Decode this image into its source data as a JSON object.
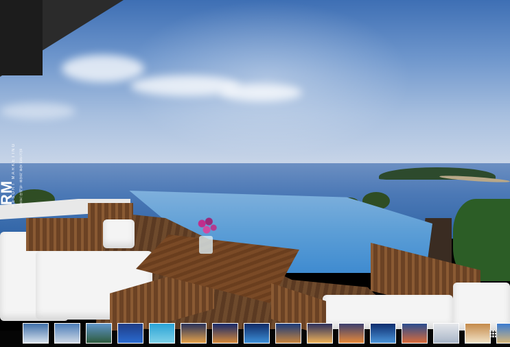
{
  "brand": {
    "logo_text": "RM",
    "tagline": "RESORT MARKETING",
    "subline": "리조트 마케팅 · 휴양지 분양 전문 기업"
  },
  "gallery": {
    "thumbnails": [
      {
        "name": "infinity-pool-sea-view",
        "colors": [
          "#3f6fa8",
          "#d8e2ee"
        ]
      },
      {
        "name": "villa-coast-aerial",
        "colors": [
          "#4b7db8",
          "#cfd9e6"
        ]
      },
      {
        "name": "beach-palms",
        "colors": [
          "#5f94c8",
          "#2d5a3d"
        ]
      },
      {
        "name": "pool-deck-night",
        "colors": [
          "#1f3c86",
          "#2a6bd0"
        ]
      },
      {
        "name": "lagoon-pool",
        "colors": [
          "#2aa3d6",
          "#7fd1e8"
        ]
      },
      {
        "name": "villa-dusk-lights",
        "colors": [
          "#27315a",
          "#e6a24a"
        ]
      },
      {
        "name": "terrace-lounge-evening",
        "colors": [
          "#16286a",
          "#d78a3a"
        ]
      },
      {
        "name": "pool-villa-night",
        "colors": [
          "#0f2a66",
          "#3c8fd8"
        ]
      },
      {
        "name": "resort-twilight",
        "colors": [
          "#1a3a7a",
          "#c9863e"
        ]
      },
      {
        "name": "villa-interior-lit",
        "colors": [
          "#2b2f5c",
          "#f0b258"
        ]
      },
      {
        "name": "pavilion-sunset",
        "colors": [
          "#3c3f6e",
          "#e88a3a"
        ]
      },
      {
        "name": "lagoon-night",
        "colors": [
          "#0d2d6e",
          "#4a93d8"
        ]
      },
      {
        "name": "deck-sunset-sea",
        "colors": [
          "#2a4c8e",
          "#d96b3a"
        ]
      },
      {
        "name": "bathroom-sea-view",
        "colors": [
          "#e4e6ea",
          "#a9b6c8"
        ]
      },
      {
        "name": "bedroom-wood",
        "colors": [
          "#c48a4a",
          "#f1e2c6"
        ]
      },
      {
        "name": "beach-sea-view",
        "colors": [
          "#3b7bd0",
          "#d6b77a"
        ]
      }
    ],
    "grid_button_label": "view all"
  }
}
